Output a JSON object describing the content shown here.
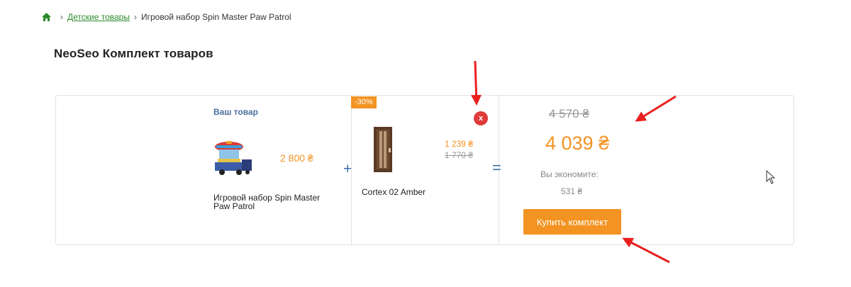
{
  "breadcrumb": {
    "home_icon": "home-icon",
    "separator": "›",
    "items": [
      "Детские товары",
      "Игровой набор Spin Master Paw Patrol"
    ]
  },
  "page_title": "NeoSeo Комплект товаров",
  "bundle": {
    "your_product_label": "Ваш товар",
    "product1": {
      "name": "Игровой набор Spin Master Paw Patrol",
      "price": "2 800 ₴",
      "image": "paw-patrol-toy-image"
    },
    "plus": "+",
    "product2": {
      "badge": "-30%",
      "remove": "x",
      "name": "Cortex 02 Amber",
      "price": "1 239 ₴",
      "old_price": "1 770 ₴",
      "image": "door-image"
    },
    "equals": "=",
    "total": {
      "old_price": "4 570 ₴",
      "new_price": "4 039 ₴",
      "save_label": "Вы экономите:",
      "save_value": "531 ₴",
      "buy_button": "Купить комплект"
    }
  },
  "colors": {
    "accent": "#f39322",
    "link": "#2c8a2c",
    "remove": "#e03b3b",
    "annotation_arrow": "#e8201e"
  }
}
